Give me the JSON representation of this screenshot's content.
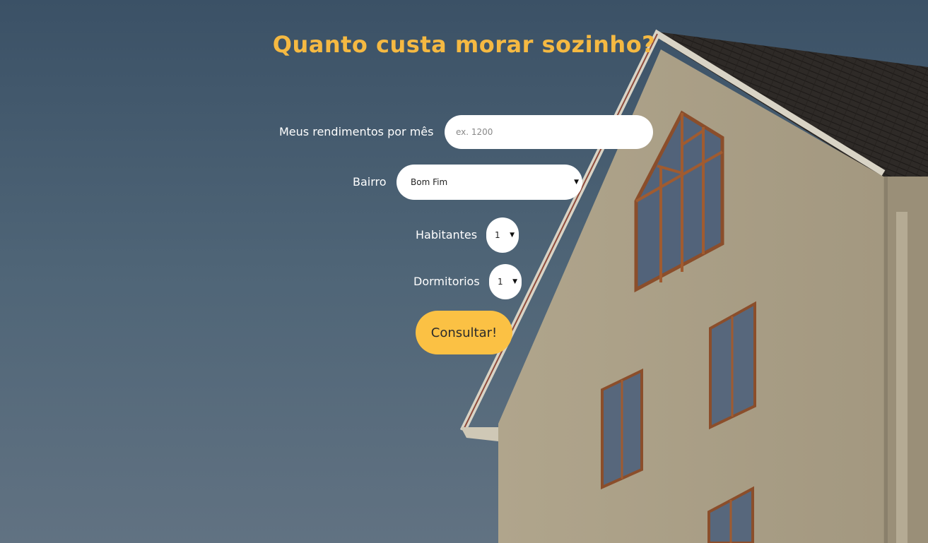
{
  "page": {
    "title": "Quanto custa morar sozinho?"
  },
  "form": {
    "income": {
      "label": "Meus rendimentos por mês",
      "placeholder": "ex. 1200",
      "value": ""
    },
    "neighborhood": {
      "label": "Bairro",
      "selected": "Bom Fim"
    },
    "inhabitants": {
      "label": "Habitantes",
      "selected": "1"
    },
    "bedrooms": {
      "label": "Dormitorios",
      "selected": "1"
    },
    "submit_label": "Consultar!"
  },
  "colors": {
    "accent": "#fbc144",
    "title": "#f5b942",
    "sky": "#4d6376"
  }
}
